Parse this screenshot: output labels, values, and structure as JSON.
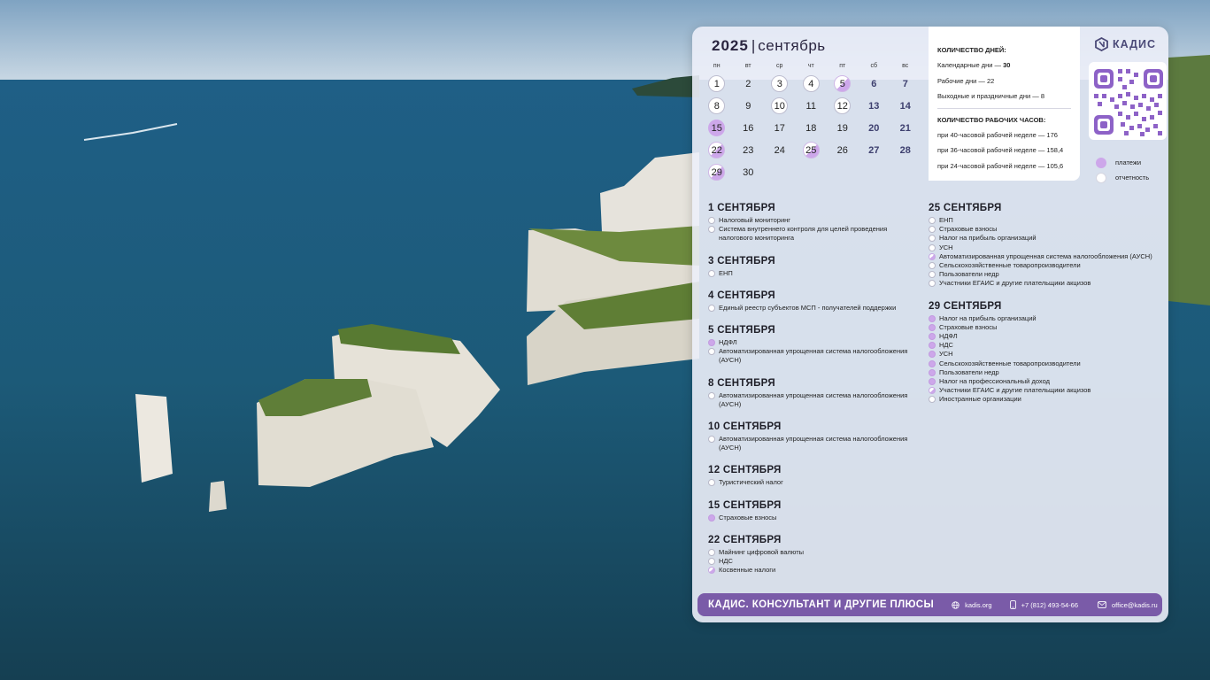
{
  "calendar": {
    "year": "2025",
    "separator": "|",
    "month": "сентябрь",
    "weekdays": [
      "пн",
      "вт",
      "ср",
      "чт",
      "пт",
      "сб",
      "вс"
    ],
    "days": [
      {
        "n": "1",
        "mark": "rep",
        "weekend": false
      },
      {
        "n": "2",
        "mark": "",
        "weekend": false
      },
      {
        "n": "3",
        "mark": "rep",
        "weekend": false
      },
      {
        "n": "4",
        "mark": "rep",
        "weekend": false
      },
      {
        "n": "5",
        "mark": "both",
        "weekend": false
      },
      {
        "n": "6",
        "mark": "",
        "weekend": true
      },
      {
        "n": "7",
        "mark": "",
        "weekend": true
      },
      {
        "n": "8",
        "mark": "rep",
        "weekend": false
      },
      {
        "n": "9",
        "mark": "",
        "weekend": false
      },
      {
        "n": "10",
        "mark": "rep",
        "weekend": false
      },
      {
        "n": "11",
        "mark": "",
        "weekend": false
      },
      {
        "n": "12",
        "mark": "rep",
        "weekend": false
      },
      {
        "n": "13",
        "mark": "",
        "weekend": true
      },
      {
        "n": "14",
        "mark": "",
        "weekend": true
      },
      {
        "n": "15",
        "mark": "pay",
        "weekend": false
      },
      {
        "n": "16",
        "mark": "",
        "weekend": false
      },
      {
        "n": "17",
        "mark": "",
        "weekend": false
      },
      {
        "n": "18",
        "mark": "",
        "weekend": false
      },
      {
        "n": "19",
        "mark": "",
        "weekend": false
      },
      {
        "n": "20",
        "mark": "",
        "weekend": true
      },
      {
        "n": "21",
        "mark": "",
        "weekend": true
      },
      {
        "n": "22",
        "mark": "both",
        "weekend": false
      },
      {
        "n": "23",
        "mark": "",
        "weekend": false
      },
      {
        "n": "24",
        "mark": "",
        "weekend": false
      },
      {
        "n": "25",
        "mark": "both",
        "weekend": false
      },
      {
        "n": "26",
        "mark": "",
        "weekend": false
      },
      {
        "n": "27",
        "mark": "",
        "weekend": true
      },
      {
        "n": "28",
        "mark": "",
        "weekend": true
      },
      {
        "n": "29",
        "mark": "both",
        "weekend": false
      },
      {
        "n": "30",
        "mark": "",
        "weekend": false
      }
    ]
  },
  "stats": {
    "days_title": "КОЛИЧЕСТВО ДНЕЙ:",
    "days": [
      {
        "label": "Календарные дни — ",
        "value": "30"
      },
      {
        "label": "Рабочие дни — ",
        "value": "22"
      },
      {
        "label": "Выходные и праздничные дни — ",
        "value": "8"
      }
    ],
    "hours_title": "КОЛИЧЕСТВО РАБОЧИХ ЧАСОВ:",
    "hours": [
      "при 40-часовой рабочей неделе — 176",
      "при 36-часовой рабочей неделе — 158,4",
      "при 24-часовой рабочей неделе — 105,6"
    ]
  },
  "logo": {
    "text": "КАДИС",
    "icon": "kadis-logo-icon"
  },
  "legend": [
    {
      "kind": "pay",
      "label": "платежи"
    },
    {
      "kind": "rep",
      "label": "отчетность"
    }
  ],
  "events_left": [
    {
      "date": "1 СЕНТЯБРЯ",
      "items": [
        {
          "k": "rep",
          "t": "Налоговый мониторинг"
        },
        {
          "k": "rep",
          "t": "Система внутреннего контроля для целей проведения налогового мониторинга"
        }
      ]
    },
    {
      "date": "3 СЕНТЯБРЯ",
      "items": [
        {
          "k": "rep",
          "t": "ЕНП"
        }
      ]
    },
    {
      "date": "4 СЕНТЯБРЯ",
      "items": [
        {
          "k": "rep",
          "t": "Единый реестр субъектов МСП - получателей поддержки"
        }
      ]
    },
    {
      "date": "5 СЕНТЯБРЯ",
      "items": [
        {
          "k": "pay",
          "t": "НДФЛ"
        },
        {
          "k": "rep",
          "t": "Автоматизированная упрощенная система налогообложения (АУСН)"
        }
      ]
    },
    {
      "date": "8 СЕНТЯБРЯ",
      "items": [
        {
          "k": "rep",
          "t": "Автоматизированная упрощенная система налогообложения (АУСН)"
        }
      ]
    },
    {
      "date": "10 СЕНТЯБРЯ",
      "items": [
        {
          "k": "rep",
          "t": "Автоматизированная упрощенная система налогообложения (АУСН)"
        }
      ]
    },
    {
      "date": "12 СЕНТЯБРЯ",
      "items": [
        {
          "k": "rep",
          "t": "Туристический налог"
        }
      ]
    },
    {
      "date": "15 СЕНТЯБРЯ",
      "items": [
        {
          "k": "pay",
          "t": "Страховые взносы"
        }
      ]
    },
    {
      "date": "22 СЕНТЯБРЯ",
      "items": [
        {
          "k": "rep",
          "t": "Майнинг цифровой валюты"
        },
        {
          "k": "rep",
          "t": "НДС"
        },
        {
          "k": "both",
          "t": "Косвенные налоги"
        }
      ]
    }
  ],
  "events_right": [
    {
      "date": "25 СЕНТЯБРЯ",
      "items": [
        {
          "k": "rep",
          "t": "ЕНП"
        },
        {
          "k": "rep",
          "t": "Страховые взносы"
        },
        {
          "k": "rep",
          "t": "Налог на прибыль организаций"
        },
        {
          "k": "rep",
          "t": "УСН"
        },
        {
          "k": "both",
          "t": "Автоматизированная упрощенная система налогообложения (АУСН)"
        },
        {
          "k": "rep",
          "t": "Сельскохозяйственные товаропроизводители"
        },
        {
          "k": "rep",
          "t": "Пользователи недр"
        },
        {
          "k": "rep",
          "t": "Участники ЕГАИС и другие плательщики акцизов"
        }
      ]
    },
    {
      "date": "29 СЕНТЯБРЯ",
      "items": [
        {
          "k": "pay",
          "t": "Налог на прибыль организаций"
        },
        {
          "k": "pay",
          "t": "Страховые взносы"
        },
        {
          "k": "pay",
          "t": "НДФЛ"
        },
        {
          "k": "pay",
          "t": "НДС"
        },
        {
          "k": "pay",
          "t": "УСН"
        },
        {
          "k": "pay",
          "t": "Сельскохозяйственные товаропроизводители"
        },
        {
          "k": "pay",
          "t": "Пользователи недр"
        },
        {
          "k": "pay",
          "t": "Налог на профессиональный доход"
        },
        {
          "k": "both",
          "t": "Участники ЕГАИС и другие плательщики акцизов"
        },
        {
          "k": "rep",
          "t": "Иностранные организации"
        }
      ]
    }
  ],
  "footer": {
    "slogan": "КАДИС. КОНСУЛЬТАНТ И ДРУГИЕ ПЛЮСЫ",
    "site": "kadis.org",
    "phone": "+7 (812) 493-54-66",
    "email": "office@kadis.ru"
  },
  "colors": {
    "payments": "#cda7ea",
    "reports": "#ffffff",
    "footer": "#7a5ba8",
    "weekend_text": "#3d3f6e"
  }
}
